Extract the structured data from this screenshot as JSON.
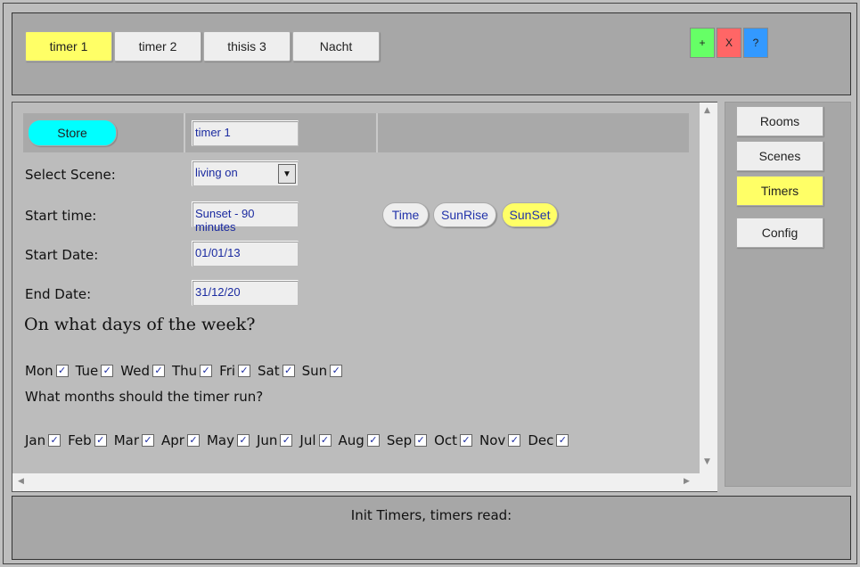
{
  "tabs": [
    "timer 1",
    "timer 2",
    "thisis 3",
    "Nacht"
  ],
  "active_tab": 0,
  "actions": {
    "add": "+",
    "delete": "X",
    "help": "?"
  },
  "colors": {
    "active": "#ffff66",
    "store": "#00ffff",
    "add": "#66ff66",
    "delete": "#ff6666",
    "help": "#3399ff"
  },
  "form": {
    "store_label": "Store",
    "timer_name": "timer 1",
    "scene_label": "Select Scene:",
    "scene_value": "living on",
    "start_time_label": "Start time:",
    "start_time_value": "Sunset - 90 minutes",
    "time_modes": [
      "Time",
      "SunRise",
      "SunSet"
    ],
    "time_mode_active": "SunSet",
    "start_date_label": "Start Date:",
    "start_date_value": "01/01/13",
    "end_date_label": "End Date:",
    "end_date_value": "31/12/20",
    "days_heading": "On what days of the week?",
    "days": [
      "Mon",
      "Tue",
      "Wed",
      "Thu",
      "Fri",
      "Sat",
      "Sun"
    ],
    "months_heading": "What months should the timer run?",
    "months": [
      "Jan",
      "Feb",
      "Mar",
      "Apr",
      "May",
      "Jun",
      "Jul",
      "Aug",
      "Sep",
      "Oct",
      "Nov",
      "Dec"
    ],
    "check_mark": "✓"
  },
  "sidebar": [
    "Rooms",
    "Scenes",
    "Timers",
    "Config"
  ],
  "sidebar_active": 2,
  "status": "Init Timers, timers read:"
}
